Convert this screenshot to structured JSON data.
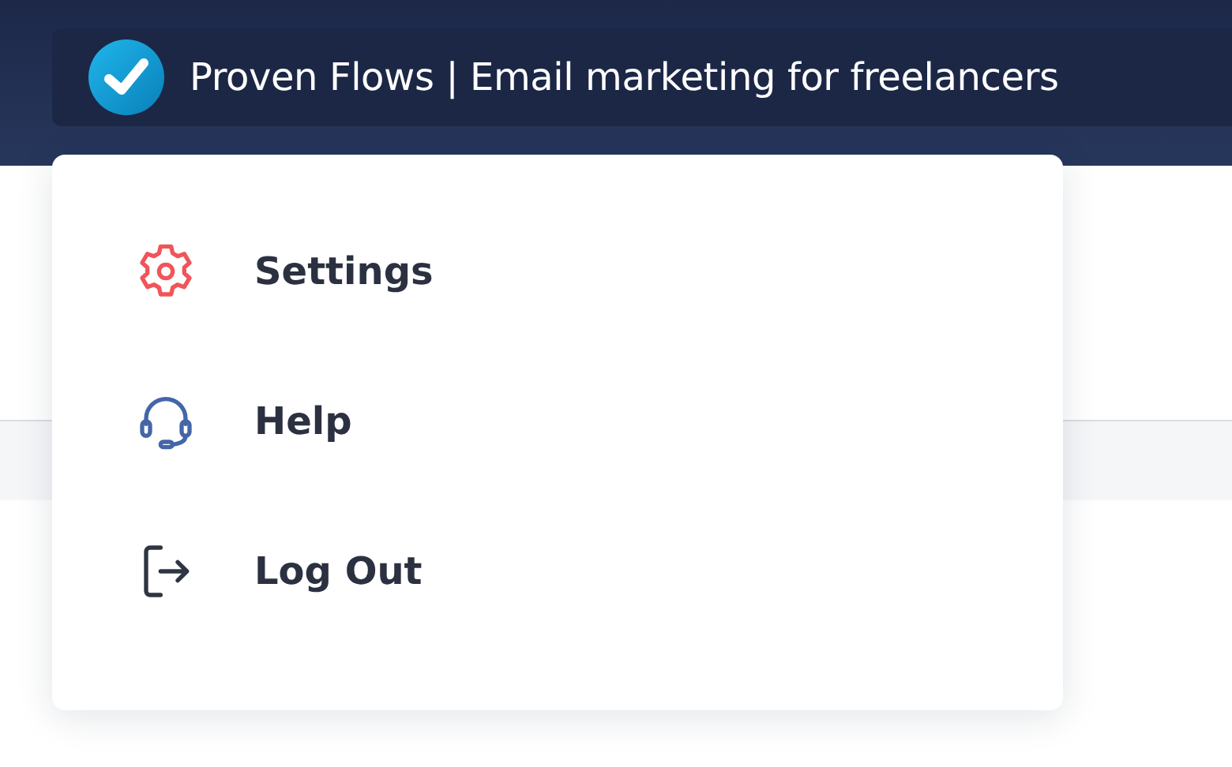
{
  "header": {
    "title": "Proven Flows | Email marketing for freelancers"
  },
  "menu": {
    "items": [
      {
        "kind": "settings",
        "label": "Settings"
      },
      {
        "kind": "help",
        "label": "Help"
      },
      {
        "kind": "logout",
        "label": "Log Out"
      }
    ]
  }
}
